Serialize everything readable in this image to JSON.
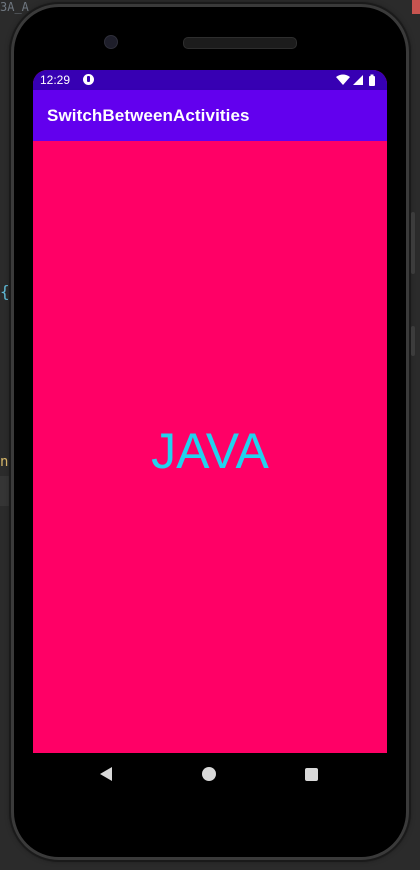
{
  "ide": {
    "tab_fragment": "3A_A",
    "code_fragment_1": "{",
    "code_fragment_2": "n"
  },
  "status_bar": {
    "time": "12:29",
    "icons": [
      "notification-icon",
      "wifi-icon",
      "signal-icon",
      "battery-icon"
    ]
  },
  "app_bar": {
    "title": "SwitchBetweenActivities"
  },
  "main": {
    "label": "JAVA"
  },
  "nav_bar": {
    "icons": [
      "back-icon",
      "home-icon",
      "recents-icon"
    ]
  },
  "colors": {
    "status_bar": "#3700b3",
    "app_bar": "#6200ee",
    "background": "#ff0066",
    "label_text": "#22d3ee"
  }
}
